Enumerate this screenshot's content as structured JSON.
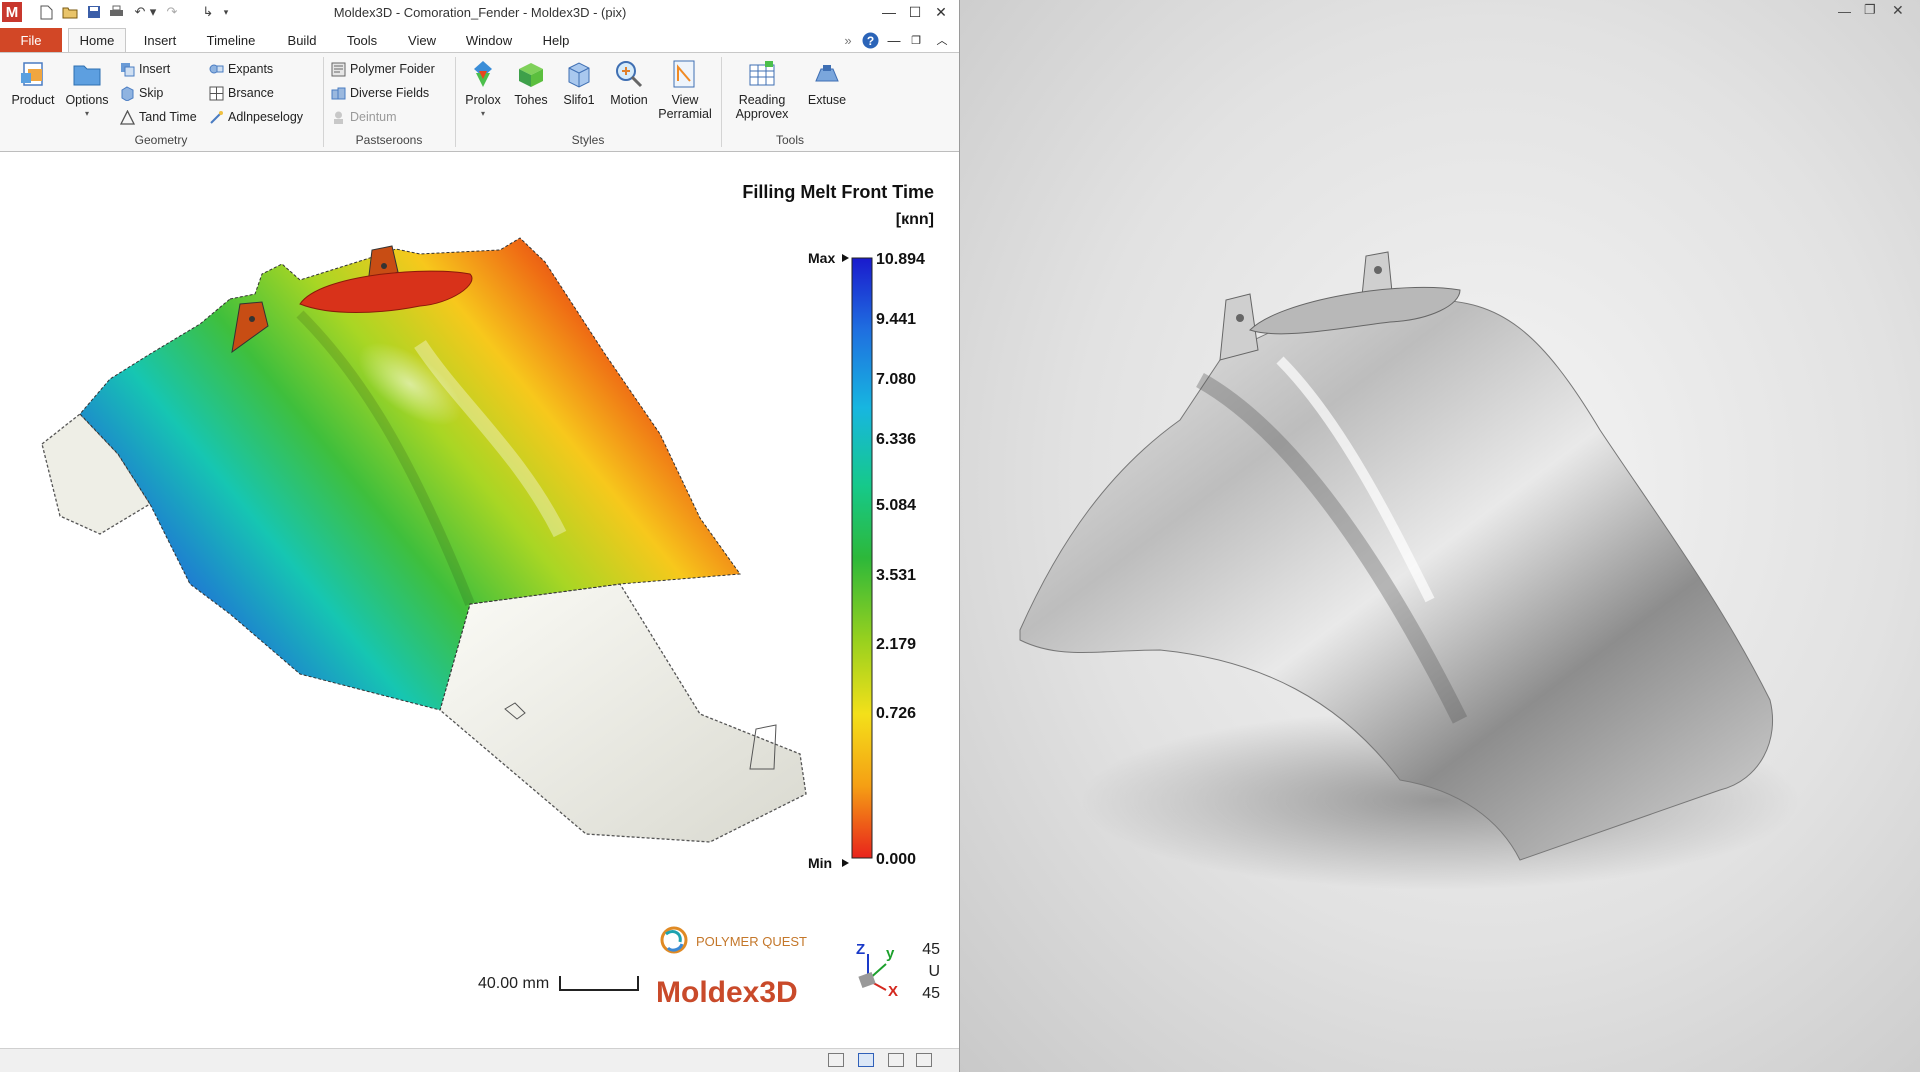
{
  "window": {
    "title": "Moldex3D - Comoration_Fender - Moldex3D - (pix)",
    "app_letter": "M",
    "ribbon_overflow": "»"
  },
  "menu": {
    "file": "File",
    "tabs": [
      "Home",
      "Insert",
      "Timeline",
      "Build",
      "Tools",
      "View",
      "Window",
      "Help"
    ]
  },
  "ribbon": {
    "geometry": {
      "label": "Geometry",
      "big": [
        "Product",
        "Options"
      ],
      "small": [
        "Insert",
        "Skip",
        "Tand Time",
        "Expants",
        "Brsance",
        "Adlnpeselogy"
      ]
    },
    "pasteroom": {
      "label": "Pastseroons",
      "small": [
        "Polymer Foider",
        "Diverse Fields",
        "Deintum"
      ]
    },
    "styles": {
      "label": "Styles",
      "big": [
        "Prolox",
        "Tohes",
        "Slifo1",
        "Motion",
        "View Perramial"
      ]
    },
    "tools": {
      "label": "Tools",
      "big": [
        "Reading Approvex",
        "Extuse"
      ]
    }
  },
  "legend": {
    "title": "Filling  Melt Front Time",
    "unit": "[кnn]",
    "max_label": "Max",
    "min_label": "Min",
    "values": [
      "10.894",
      "9.441",
      "7.080",
      "6.336",
      "5.084",
      "3.531",
      "2.179",
      "0.726",
      "0.000"
    ],
    "colors": [
      "#1a1acd",
      "#1f6fe0",
      "#17b6e0",
      "#16c98a",
      "#2db83a",
      "#9ad11e",
      "#f3e01a",
      "#f59f14",
      "#e8231c"
    ]
  },
  "scale_bar": {
    "label": "40.00 mm"
  },
  "branding": {
    "partner": "POLYMER QUEST",
    "product": "Moldex3D"
  },
  "triad": {
    "z": "Z",
    "y": "y",
    "x": "X",
    "readout": [
      "45",
      "U",
      "45"
    ]
  },
  "icons": [
    "new-file-icon",
    "open-folder-icon",
    "save-icon",
    "print-icon",
    "undo-icon",
    "redo-icon",
    "help-icon",
    "minimize-icon",
    "maximize-icon",
    "close-icon"
  ]
}
